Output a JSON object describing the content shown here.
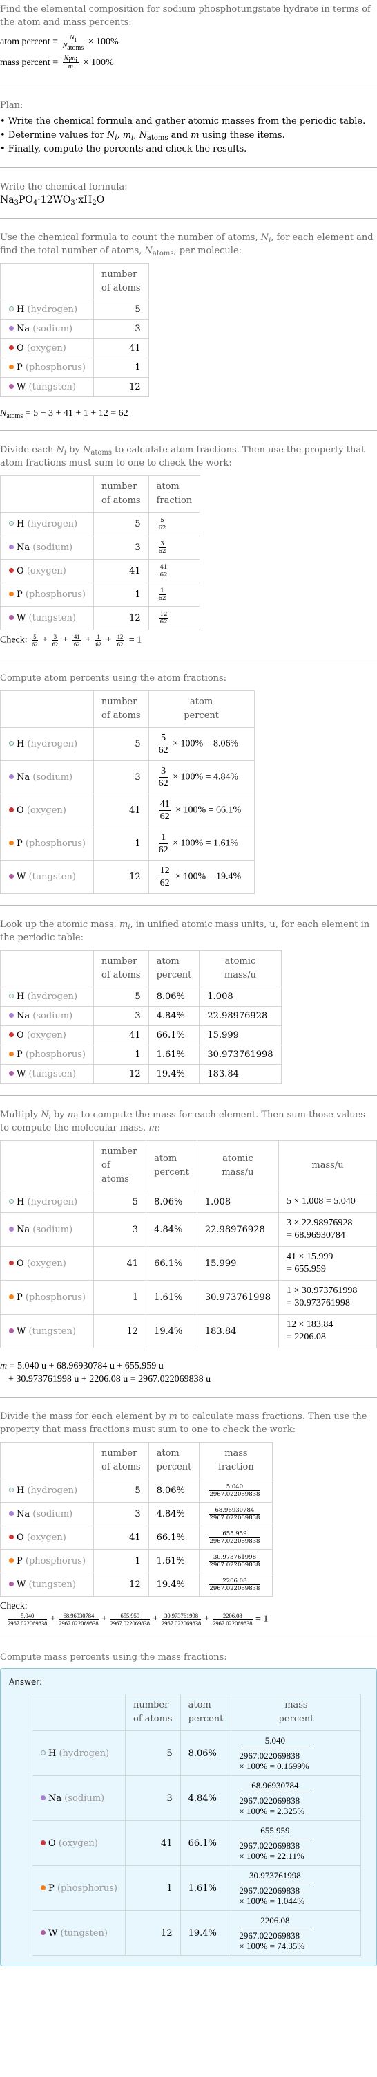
{
  "intro": {
    "text": "Find the elemental composition for sodium phosphotungstate hydrate in terms of the atom and mass percents:",
    "atom_percent_label": "atom percent =",
    "mass_percent_label": "mass percent =",
    "times_100": "× 100%",
    "atom_formula_num": "N",
    "atom_formula_num_sub": "i",
    "atom_formula_den": "N",
    "atom_formula_den_sub": "atoms",
    "mass_formula_num": "N",
    "mass_formula_num_sub": "i",
    "mass_formula_num2": "m",
    "mass_formula_num2_sub": "i",
    "mass_formula_den": "m"
  },
  "plan": {
    "title": "Plan:",
    "items": [
      "Write the chemical formula and gather atomic masses from the periodic table.",
      "Determine values for N_i, m_i, N_atoms and m using these items.",
      "Finally, compute the percents and check the results."
    ]
  },
  "formula_section": {
    "title": "Write the chemical formula:",
    "formula": "Na3PO4·12WO3·xH2O"
  },
  "elements": [
    {
      "symbol": "H",
      "name": "(hydrogen)",
      "color": "#e6f7f8",
      "border": "#8aa4a8",
      "count": "5",
      "fraction_num": "5",
      "fraction_den": "62",
      "atom_percent": "8.06%",
      "atomic_mass": "1.008",
      "mass_expr": "5 × 1.008 = 5.040",
      "mass_expr_1": "5 × 1.008 = 5.040",
      "mass_expr_2": "",
      "mass": "5.040",
      "mass_percent": "× 100% = 0.1699%"
    },
    {
      "symbol": "Na",
      "name": "(sodium)",
      "color": "#a97fd3",
      "border": "#a97fd3",
      "count": "3",
      "fraction_num": "3",
      "fraction_den": "62",
      "atom_percent": "4.84%",
      "atomic_mass": "22.98976928",
      "mass_expr_1": "3 × 22.98976928",
      "mass_expr_2": "= 68.96930784",
      "mass": "68.96930784",
      "mass_percent": "× 100% = 2.325%"
    },
    {
      "symbol": "O",
      "name": "(oxygen)",
      "color": "#cc3333",
      "border": "#cc3333",
      "count": "41",
      "fraction_num": "41",
      "fraction_den": "62",
      "atom_percent": "66.1%",
      "atomic_mass": "15.999",
      "mass_expr_1": "41 × 15.999",
      "mass_expr_2": "= 655.959",
      "mass": "655.959",
      "mass_percent": "× 100% = 22.11%"
    },
    {
      "symbol": "P",
      "name": "(phosphorus)",
      "color": "#f57f16",
      "border": "#f57f16",
      "count": "1",
      "fraction_num": "1",
      "fraction_den": "62",
      "atom_percent": "1.61%",
      "atomic_mass": "30.973761998",
      "mass_expr_1": "1 × 30.973761998",
      "mass_expr_2": "= 30.973761998",
      "mass": "30.973761998",
      "mass_percent": "× 100% = 1.044%"
    },
    {
      "symbol": "W",
      "name": "(tungsten)",
      "color": "#b05ba6",
      "border": "#b05ba6",
      "count": "12",
      "fraction_num": "12",
      "fraction_den": "62",
      "atom_percent": "19.4%",
      "atomic_mass": "183.84",
      "mass_expr_1": "12 × 183.84",
      "mass_expr_2": "= 2206.08",
      "mass": "2206.08",
      "mass_percent": "× 100% = 74.35%"
    }
  ],
  "headers": {
    "number_of_atoms_1": "number",
    "number_of_atoms_2": "of atoms",
    "atom_fraction_1": "atom",
    "atom_fraction_2": "fraction",
    "atom_percent_1": "atom",
    "atom_percent_2": "percent",
    "atomic_mass_1": "atomic",
    "atomic_mass_2": "mass/u",
    "mass": "mass/u",
    "mass_fraction_1": "mass",
    "mass_fraction_2": "fraction",
    "mass_percent_1": "mass",
    "mass_percent_2": "percent"
  },
  "count_section": {
    "text_1": "Use the chemical formula to count the number of atoms, ",
    "text_2": ", for each element and find the total number of atoms, ",
    "text_3": ", per molecule:",
    "natoms_eq": "= 5 + 3 + 41 + 1 + 12 = 62"
  },
  "fraction_section": {
    "text_1": "Divide each ",
    "text_2": " by ",
    "text_3": " to calculate atom fractions. Then use the property that atom fractions must sum to one to check the work:",
    "check_label": "Check:",
    "check_result": "= 1"
  },
  "atom_percent_section": {
    "text": "Compute atom percents using the atom fractions:",
    "times": "× 100% ="
  },
  "mass_lookup_section": {
    "text_1": "Look up the atomic mass, ",
    "text_2": ", in unified atomic mass units, u, for each element in the periodic table:"
  },
  "molecular_mass_section": {
    "text_1": "Multiply ",
    "text_2": " by ",
    "text_3": " to compute the mass for each element. Then sum those values to compute the molecular mass, ",
    "text_4": ":",
    "eq_line_1": "= 5.040 u + 68.96930784 u + 655.959 u",
    "eq_line_2": "+ 30.973761998 u + 2206.08 u = 2967.022069838 u"
  },
  "mass_fraction_section": {
    "text_1": "Divide the mass for each element by ",
    "text_2": " to calculate mass fractions. Then use the property that mass fractions must sum to one to check the work:",
    "denominator": "2967.022069838",
    "check_label": "Check:",
    "check_result": "= 1"
  },
  "mass_percent_section": {
    "text": "Compute mass percents using the mass fractions:",
    "answer_label": "Answer:"
  }
}
